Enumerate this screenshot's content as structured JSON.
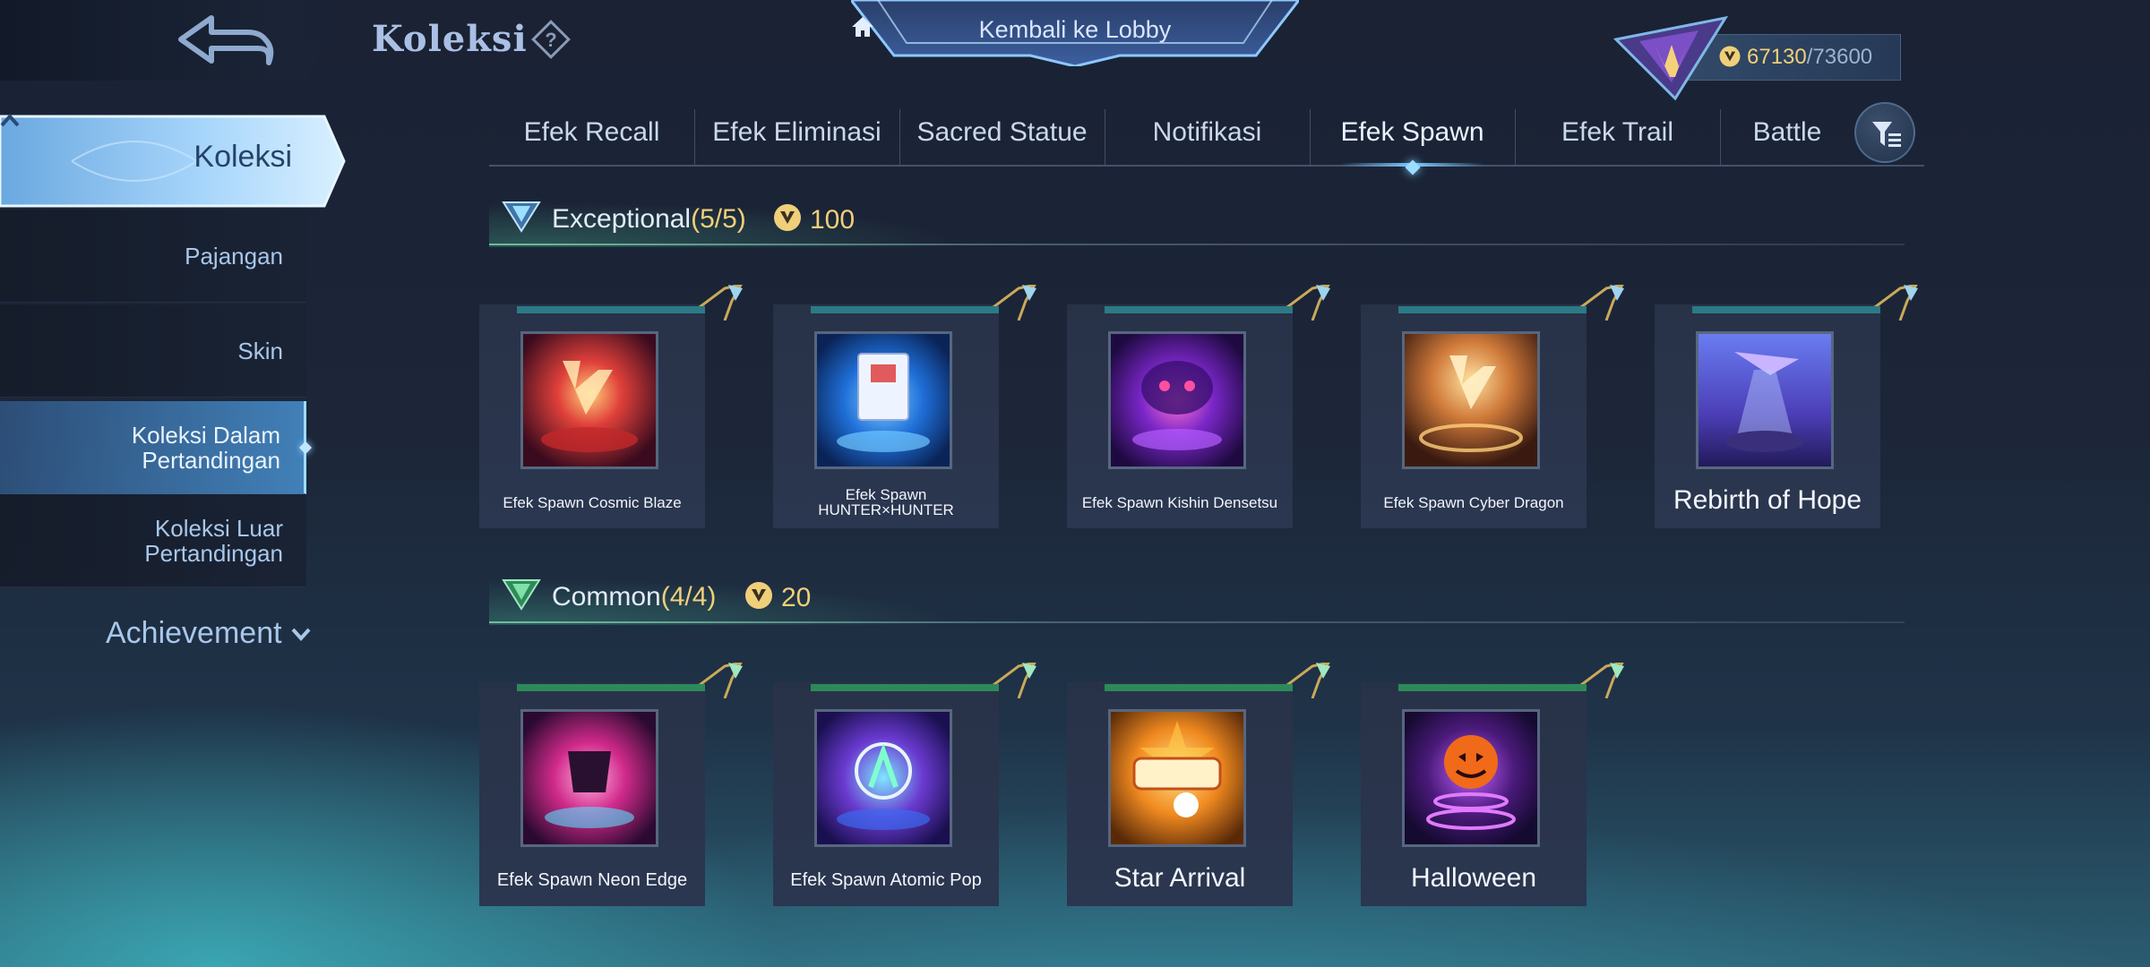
{
  "header": {
    "title": "Koleksi",
    "lobby_label": "Kembali ke Lobby",
    "points_current": "67130",
    "points_total": "/73600"
  },
  "sidebar": {
    "main_label": "Koleksi",
    "items": [
      {
        "label": "Pajangan"
      },
      {
        "label": "Skin"
      },
      {
        "label": "Koleksi Dalam Pertandingan",
        "active": true
      },
      {
        "label": "Koleksi Luar Pertandingan"
      }
    ],
    "achievement_label": "Achievement"
  },
  "tabs": [
    {
      "label": "Efek Recall"
    },
    {
      "label": "Efek Eliminasi"
    },
    {
      "label": "Sacred Statue"
    },
    {
      "label": "Notifikasi"
    },
    {
      "label": "Efek Spawn",
      "active": true
    },
    {
      "label": "Efek Trail"
    },
    {
      "label": "Battle"
    }
  ],
  "sections": {
    "exceptional": {
      "title": "Exceptional",
      "count": "(5/5)",
      "points": "100",
      "items": [
        {
          "name": "Efek Spawn Cosmic Blaze"
        },
        {
          "name": "Efek Spawn HUNTER×HUNTER"
        },
        {
          "name": "Efek Spawn Kishin Densetsu"
        },
        {
          "name": "Efek Spawn Cyber Dragon"
        },
        {
          "name": "Rebirth of Hope"
        }
      ]
    },
    "common": {
      "title": "Common",
      "count": "(4/4)",
      "points": "20",
      "items": [
        {
          "name": "Efek Spawn Neon Edge"
        },
        {
          "name": "Efek Spawn Atomic Pop"
        },
        {
          "name": "Star Arrival"
        },
        {
          "name": "Halloween"
        }
      ]
    }
  },
  "colors": {
    "accent_gold": "#f0cf7a",
    "active_blue": "#7ccbff",
    "card_bg": "#283247"
  },
  "icons": [
    "back-arrow-icon",
    "help-icon",
    "home-icon",
    "rank-emblem-icon",
    "collection-point-icon",
    "filter-icon",
    "chevron-up-icon",
    "chevron-down-icon"
  ]
}
